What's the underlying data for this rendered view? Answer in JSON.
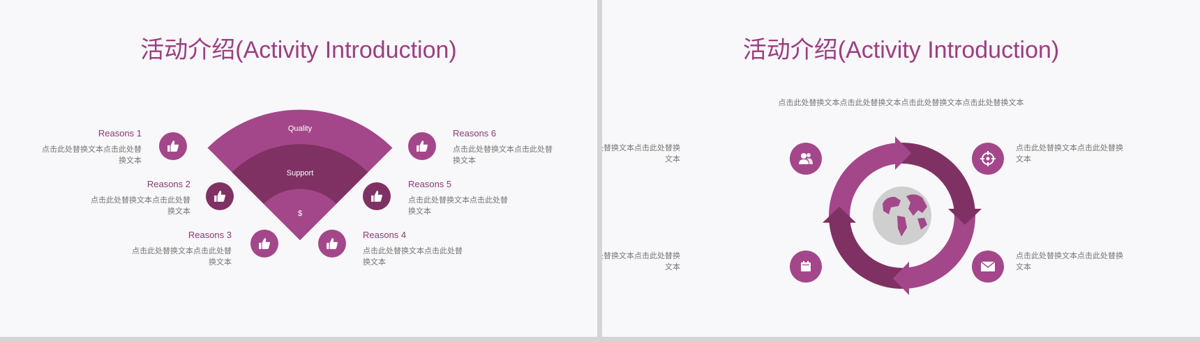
{
  "colors": {
    "primary": "#a3478a",
    "dark": "#803163",
    "title": "#9a3f82",
    "text": "#777777"
  },
  "left_slide": {
    "title": "活动介绍(Activity Introduction)",
    "fan_labels": {
      "quality": "Quality",
      "support": "Support",
      "center": "$"
    },
    "reasons": [
      {
        "title": "Reasons 1",
        "desc": "点击此处替换文本点击此处替换文本"
      },
      {
        "title": "Reasons 2",
        "desc": "点击此处替换文本点击此处替换文本"
      },
      {
        "title": "Reasons 3",
        "desc": "点击此处替换文本点击此处替换文本"
      },
      {
        "title": "Reasons 4",
        "desc": "点击此处替换文本点击此处替换文本"
      },
      {
        "title": "Reasons 5",
        "desc": "点击此处替换文本点击此处替换文本"
      },
      {
        "title": "Reasons 6",
        "desc": "点击此处替换文本点击此处替换文本"
      }
    ],
    "icon": "thumbs-up-icon"
  },
  "right_slide": {
    "title": "活动介绍(Activity Introduction)",
    "subtitle": "点击此处替换文本点击此处替换文本点击此处替换文本点击此处替换文本",
    "items": [
      {
        "desc": "点击此处替换文本点击此处替换文本",
        "icon": "users-icon"
      },
      {
        "desc": "点击此处替换文本点击此处替换文本",
        "icon": "target-icon"
      },
      {
        "desc": "点击此处替换文本点击此处替换文本",
        "icon": "calendar-icon"
      },
      {
        "desc": "点击此处替换文本点击此处替换文本",
        "icon": "mail-icon"
      }
    ],
    "center_icon": "globe-icon"
  }
}
